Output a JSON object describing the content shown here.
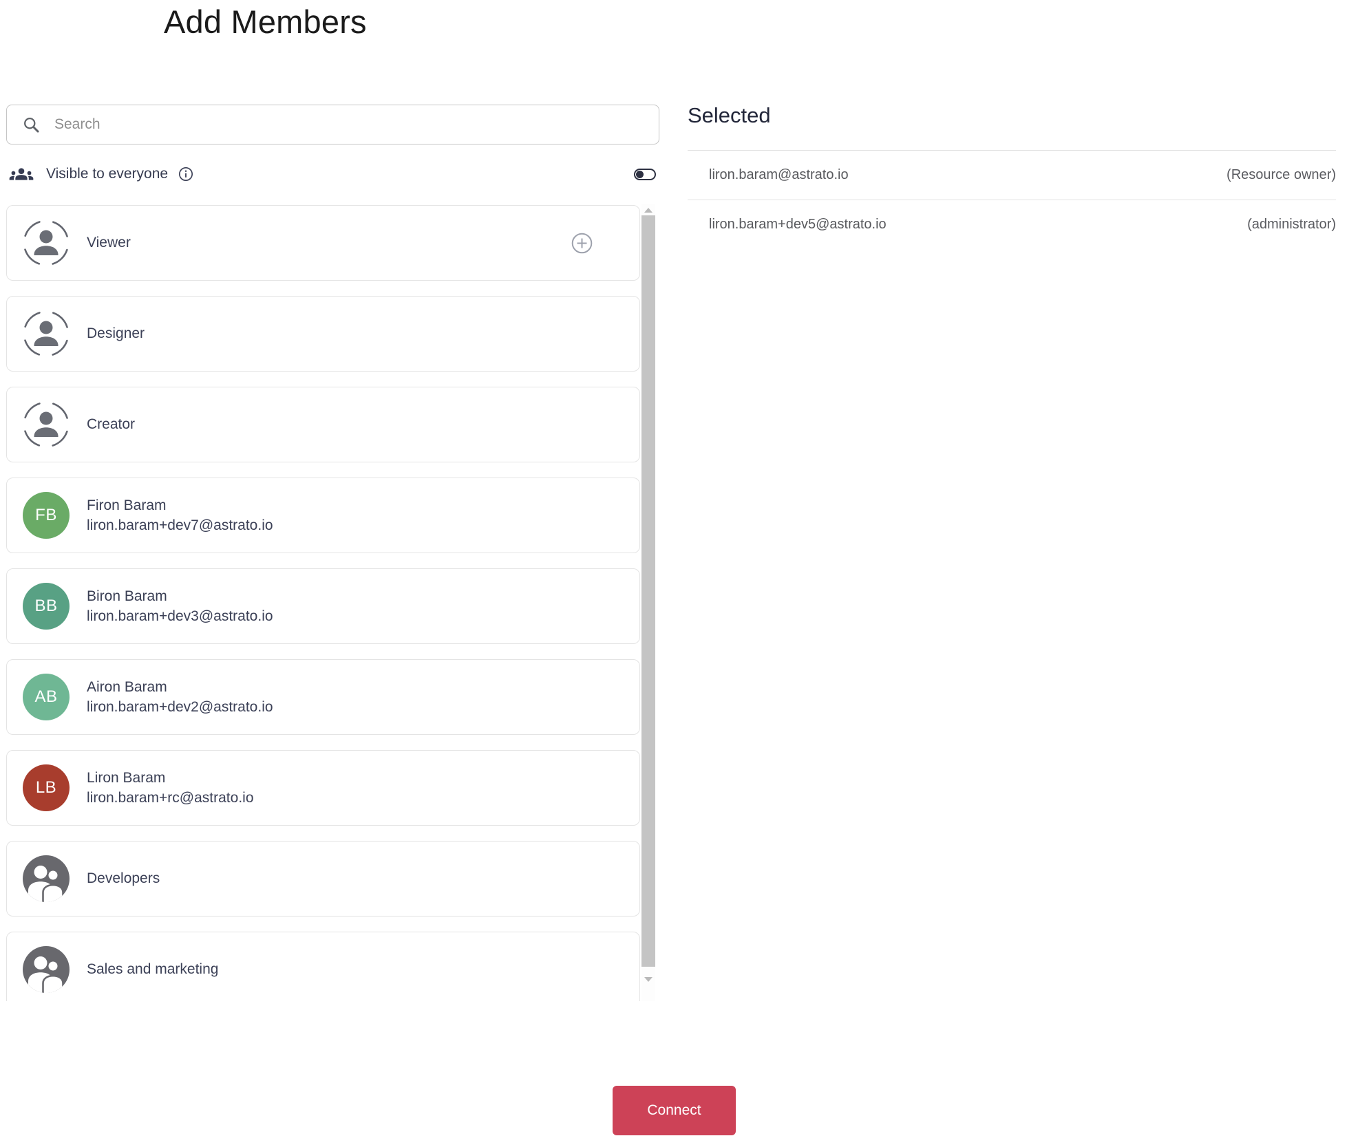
{
  "page": {
    "title": "Add Members"
  },
  "search": {
    "placeholder": "Search"
  },
  "visibility": {
    "label": "Visible to everyone",
    "toggle_state": "off"
  },
  "roles": [
    {
      "label": "Viewer"
    },
    {
      "label": "Designer"
    },
    {
      "label": "Creator"
    }
  ],
  "users": [
    {
      "initials": "FB",
      "name": "Firon Baram",
      "email": "liron.baram+dev7@astrato.io",
      "color": "#6aab66"
    },
    {
      "initials": "BB",
      "name": "Biron Baram",
      "email": "liron.baram+dev3@astrato.io",
      "color": "#58a184"
    },
    {
      "initials": "AB",
      "name": "Airon Baram",
      "email": "liron.baram+dev2@astrato.io",
      "color": "#6fb794"
    },
    {
      "initials": "LB",
      "name": "Liron Baram",
      "email": "liron.baram+rc@astrato.io",
      "color": "#a83d2d"
    }
  ],
  "groups": [
    {
      "label": "Developers"
    },
    {
      "label": "Sales and marketing"
    }
  ],
  "selected": {
    "heading": "Selected",
    "items": [
      {
        "email": "liron.baram@astrato.io",
        "role": "(Resource owner)"
      },
      {
        "email": "liron.baram+dev5@astrato.io",
        "role": "(administrator)"
      }
    ]
  },
  "actions": {
    "connect_label": "Connect"
  },
  "colors": {
    "primary_action": "#cd4257",
    "toggle": "#2d3142",
    "group_avatar": "#68686d"
  }
}
